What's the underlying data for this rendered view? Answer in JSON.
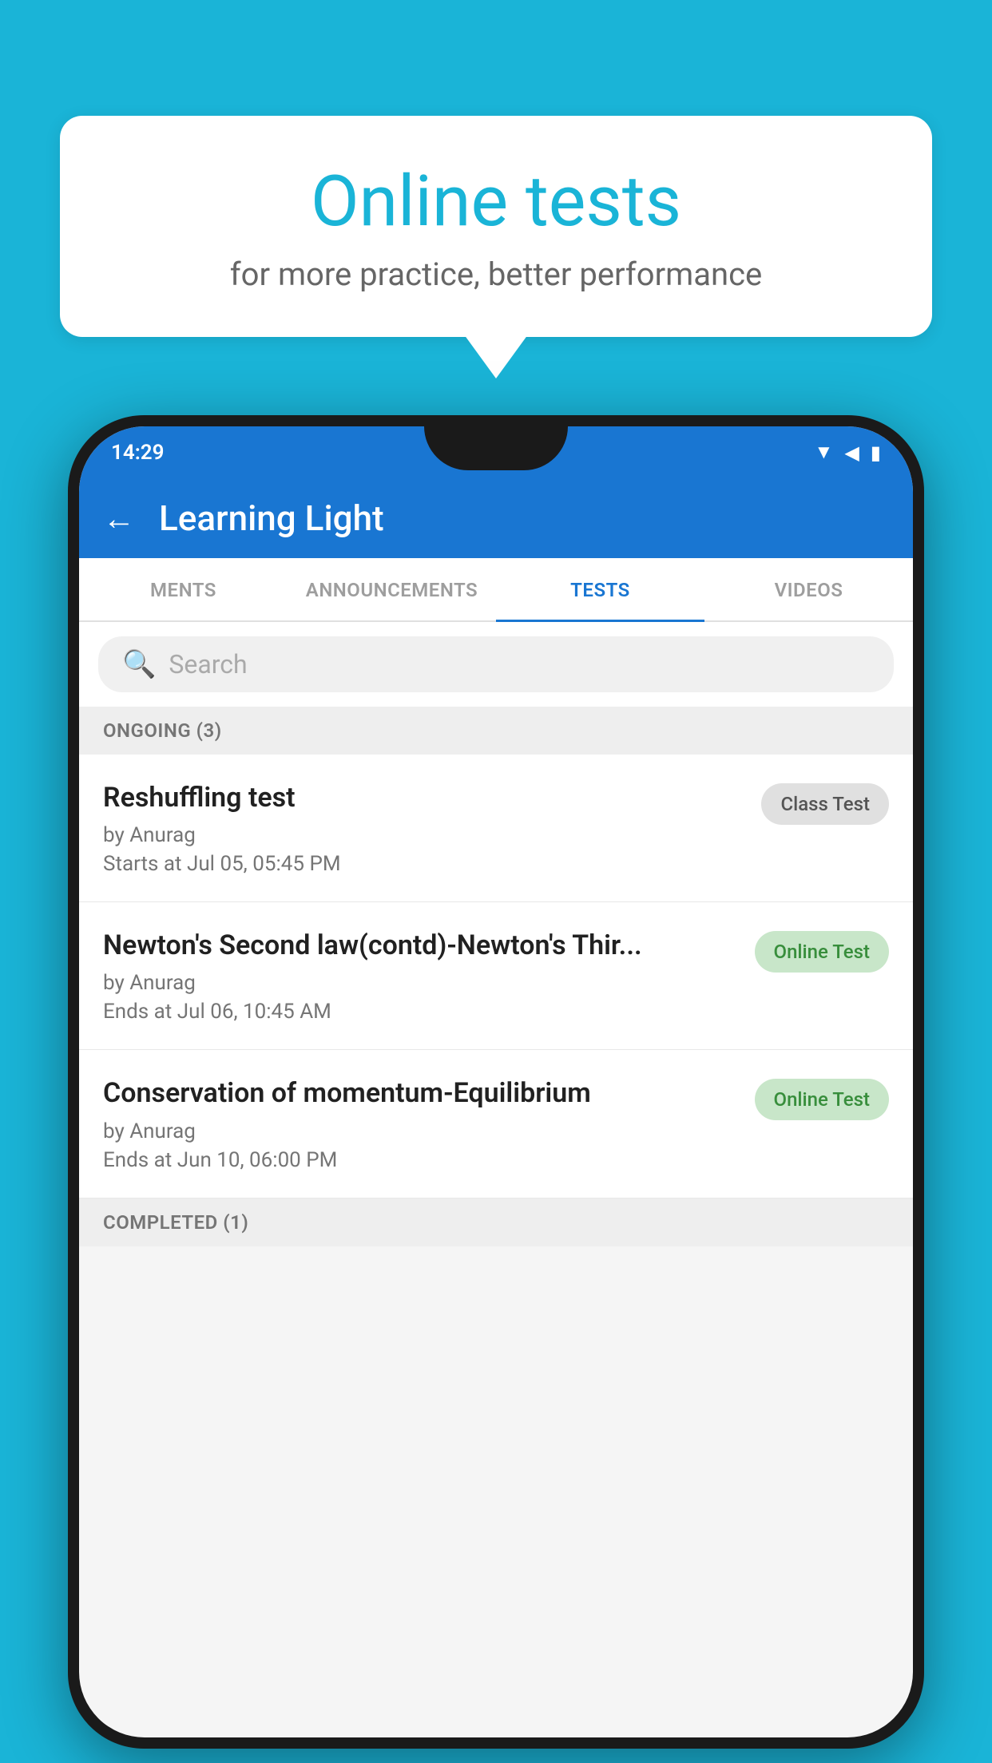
{
  "background": {
    "color": "#1ab4d7"
  },
  "speech_bubble": {
    "title": "Online tests",
    "subtitle": "for more practice, better performance"
  },
  "phone": {
    "status_bar": {
      "time": "14:29",
      "wifi_icon": "▼",
      "signal_icon": "◀",
      "battery_icon": "▮"
    },
    "app_header": {
      "back_label": "←",
      "title": "Learning Light"
    },
    "tabs": [
      {
        "label": "MENTS",
        "active": false
      },
      {
        "label": "ANNOUNCEMENTS",
        "active": false
      },
      {
        "label": "TESTS",
        "active": true
      },
      {
        "label": "VIDEOS",
        "active": false
      }
    ],
    "search": {
      "placeholder": "Search"
    },
    "sections": [
      {
        "header": "ONGOING (3)",
        "items": [
          {
            "name": "Reshuffling test",
            "by": "by Anurag",
            "date": "Starts at  Jul 05, 05:45 PM",
            "badge": "Class Test",
            "badge_type": "class"
          },
          {
            "name": "Newton's Second law(contd)-Newton's Thir...",
            "by": "by Anurag",
            "date": "Ends at  Jul 06, 10:45 AM",
            "badge": "Online Test",
            "badge_type": "online"
          },
          {
            "name": "Conservation of momentum-Equilibrium",
            "by": "by Anurag",
            "date": "Ends at  Jun 10, 06:00 PM",
            "badge": "Online Test",
            "badge_type": "online"
          }
        ]
      }
    ],
    "completed_label": "COMPLETED (1)"
  }
}
